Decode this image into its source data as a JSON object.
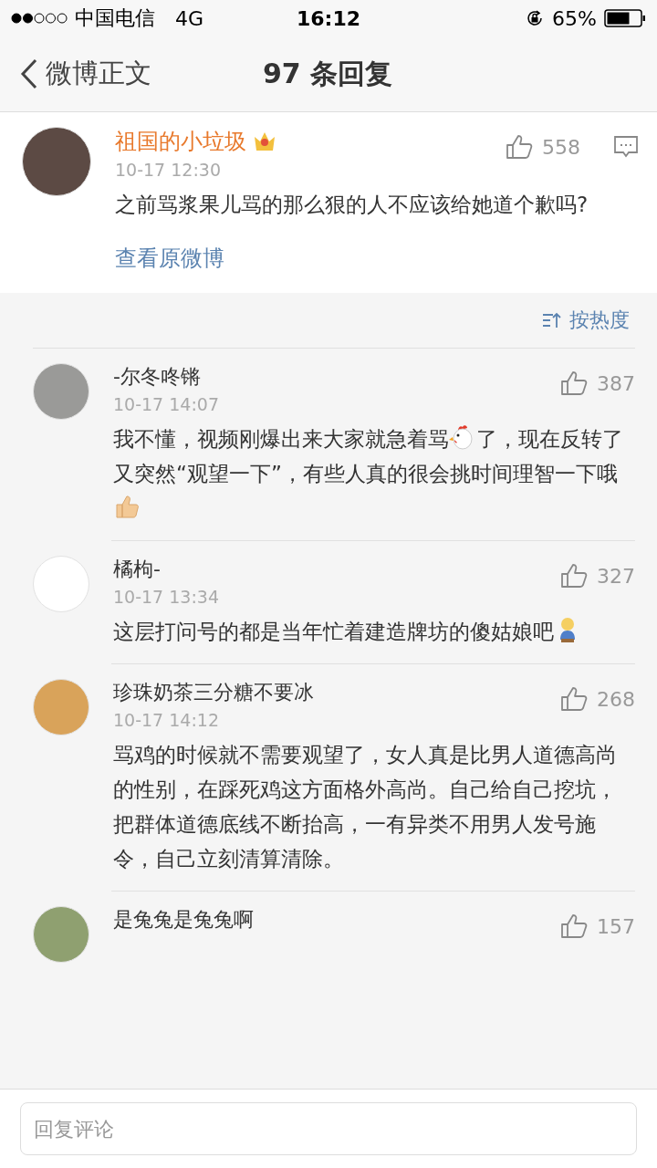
{
  "status_bar": {
    "carrier": "中国电信",
    "network": "4G",
    "time": "16:12",
    "battery": "65%"
  },
  "nav": {
    "back": "微博正文",
    "title": "97 条回复"
  },
  "post": {
    "name": "祖国的小垃圾",
    "time": "10-17 12:30",
    "likes": "558",
    "body": "之前骂浆果儿骂的那么狠的人不应该给她道个歉吗?",
    "link": "查看原微博"
  },
  "sort": {
    "label": "按热度"
  },
  "comments": [
    {
      "name": "-尔冬咚锵",
      "time": "10-17 14:07",
      "likes": "387",
      "body": [
        {
          "kind": "text",
          "text": "我不懂，视频刚爆出来大家就急着骂"
        },
        {
          "kind": "chicken"
        },
        {
          "kind": "text",
          "text": "了，现在反转了又突然“观望一下”，有些人真的很会挑时间理智一下哦"
        },
        {
          "kind": "thumbs-up"
        }
      ]
    },
    {
      "name": "橘枸-",
      "time": "10-17 13:34",
      "likes": "327",
      "body": [
        {
          "kind": "text",
          "text": "这层打问号的都是当年忙着建造牌坊的傻姑娘吧"
        },
        {
          "kind": "person"
        }
      ]
    },
    {
      "name": "珍珠奶茶三分糖不要冰",
      "time": "10-17 14:12",
      "likes": "268",
      "body": [
        {
          "kind": "text",
          "text": "骂鸡的时候就不需要观望了，女人真是比男人道德高尚的性别，在踩死鸡这方面格外高尚。自己给自己挖坑，把群体道德底线不断抬高，一有异类不用男人发号施令，自己立刻清算清除。"
        }
      ]
    },
    {
      "name": "是兔兔是兔兔啊",
      "likes": "157"
    }
  ],
  "reply": {
    "placeholder": "回复评论"
  }
}
